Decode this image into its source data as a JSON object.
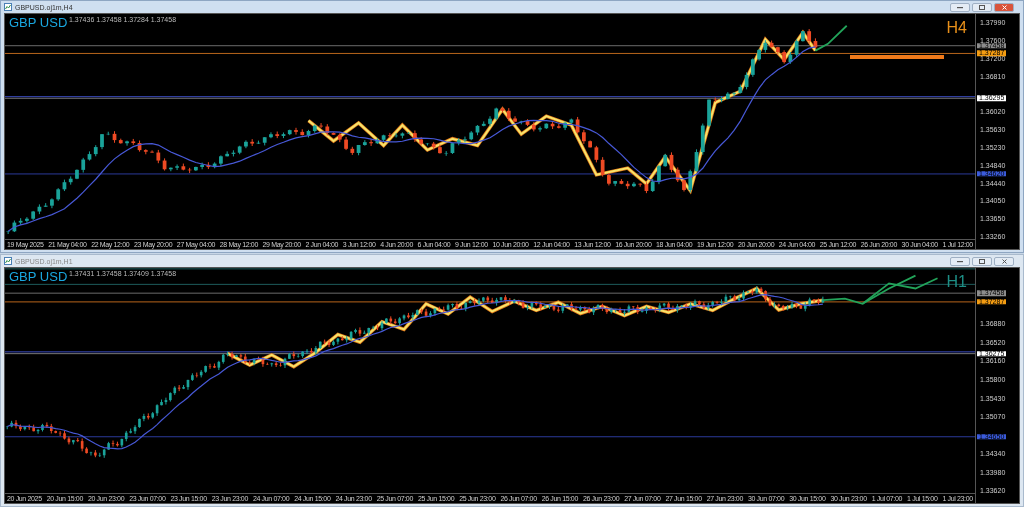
{
  "windows": [
    {
      "title": "GBPUSD.oj1m,H4",
      "active": true,
      "symbol_label": "GBP USD",
      "timeframe_label": "H4",
      "ohlc_info": "1.37436 1.37458 1.37284 1.37458",
      "price_ticks": [
        "1.37990",
        "1.37600",
        "1.37200",
        "1.36810",
        "1.36020",
        "1.35630",
        "1.35230",
        "1.34840",
        "1.34440",
        "1.34050",
        "1.33650",
        "1.33260"
      ],
      "price_tags": [
        {
          "text": "1.37458",
          "color": "#8c8c8c"
        },
        {
          "text": "1.37287",
          "color": "#f39c12"
        },
        {
          "text": "1.36295",
          "color": "#ffffff"
        },
        {
          "text": "1.34620",
          "color": "#3b5bdb"
        }
      ],
      "time_ticks": [
        "19 May 2025",
        "21 May 04:00",
        "22 May 12:00",
        "23 May 20:00",
        "27 May 04:00",
        "28 May 12:00",
        "29 May 20:00",
        "2 Jun 04:00",
        "3 Jun 12:00",
        "4 Jun 20:00",
        "6 Jun 04:00",
        "9 Jun 12:00",
        "10 Jun 20:00",
        "12 Jun 04:00",
        "13 Jun 12:00",
        "16 Jun 20:00",
        "18 Jun 04:00",
        "19 Jun 12:00",
        "20 Jun 20:00",
        "24 Jun 04:00",
        "25 Jun 12:00",
        "26 Jun 20:00",
        "30 Jun 04:00",
        "1 Jul 12:00"
      ]
    },
    {
      "title": "GBPUSD.oj1m,H1",
      "active": false,
      "symbol_label": "GBP USD",
      "timeframe_label": "H1",
      "ohlc_info": "1.37431 1.37458 1.37409 1.37458",
      "price_ticks": [
        "1.36880",
        "1.36520",
        "1.36160",
        "1.35800",
        "1.35430",
        "1.35070",
        "1.34340",
        "1.33980",
        "1.33620"
      ],
      "price_tags": [
        {
          "text": "1.37458",
          "color": "#8c8c8c"
        },
        {
          "text": "1.37287",
          "color": "#f39c12"
        },
        {
          "text": "1.36275",
          "color": "#ffffff"
        },
        {
          "text": "1.34650",
          "color": "#3b5bdb"
        }
      ],
      "time_ticks": [
        "20 Jun 2025",
        "20 Jun 15:00",
        "20 Jun 23:00",
        "23 Jun 07:00",
        "23 Jun 15:00",
        "23 Jun 23:00",
        "24 Jun 07:00",
        "24 Jun 15:00",
        "24 Jun 23:00",
        "25 Jun 07:00",
        "25 Jun 15:00",
        "25 Jun 23:00",
        "26 Jun 07:00",
        "26 Jun 15:00",
        "26 Jun 23:00",
        "27 Jun 07:00",
        "27 Jun 15:00",
        "27 Jun 23:00",
        "30 Jun 07:00",
        "30 Jun 15:00",
        "30 Jun 23:00",
        "1 Jul 07:00",
        "1 Jul 15:00",
        "1 Jul 23:00"
      ]
    }
  ]
}
